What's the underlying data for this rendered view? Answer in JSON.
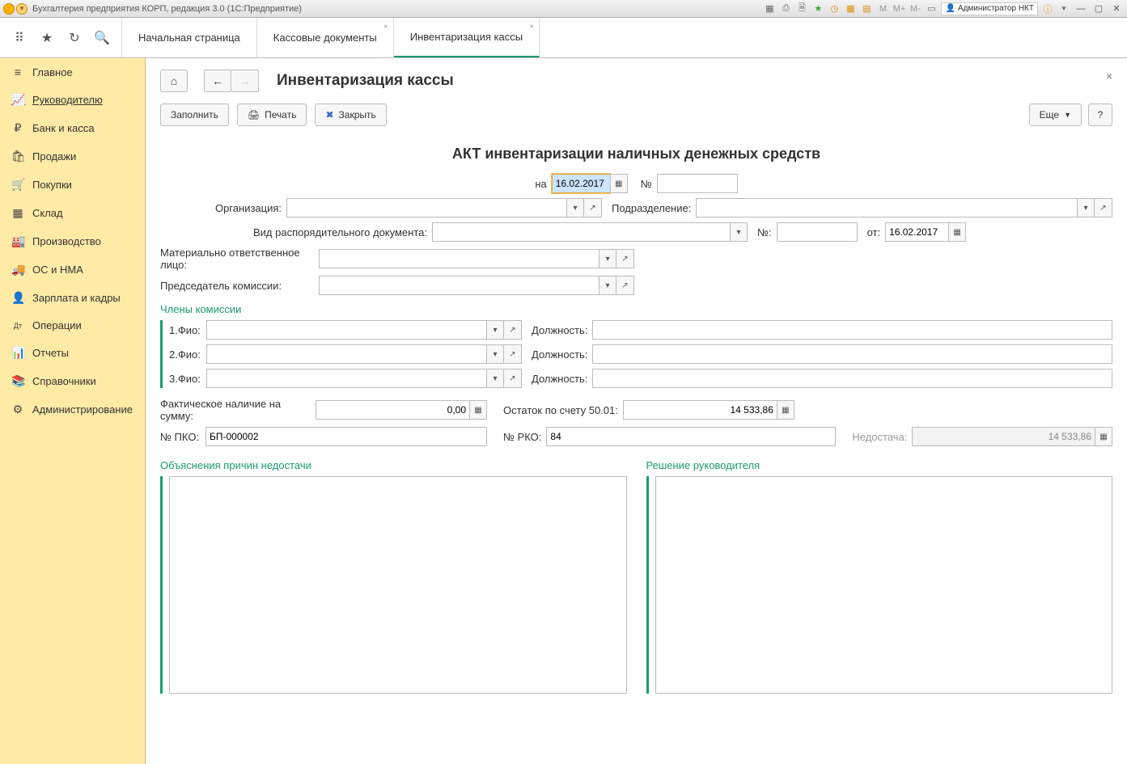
{
  "titlebar": {
    "app_title": "Бухгалтерия предприятия КОРП, редакция 3.0  (1С:Предприятие)",
    "user": "Администратор НКТ",
    "tool_labels": [
      "M",
      "M+",
      "M-"
    ]
  },
  "topbar": {
    "tabs": [
      {
        "label": "Начальная страница",
        "closable": false
      },
      {
        "label": "Кассовые документы",
        "closable": true
      },
      {
        "label": "Инвентаризация кассы",
        "closable": true,
        "active": true
      }
    ]
  },
  "sidebar": {
    "items": [
      {
        "icon": "≡",
        "label": "Главное"
      },
      {
        "icon": "📈",
        "label": "Руководителю",
        "active": true
      },
      {
        "icon": "₽",
        "label": "Банк и касса"
      },
      {
        "icon": "🛍",
        "label": "Продажи"
      },
      {
        "icon": "🛒",
        "label": "Покупки"
      },
      {
        "icon": "▦",
        "label": "Склад"
      },
      {
        "icon": "🏭",
        "label": "Производство"
      },
      {
        "icon": "🚚",
        "label": "ОС и НМА"
      },
      {
        "icon": "👤",
        "label": "Зарплата и кадры"
      },
      {
        "icon": "Дт",
        "label": "Операции"
      },
      {
        "icon": "📊",
        "label": "Отчеты"
      },
      {
        "icon": "📚",
        "label": "Справочники"
      },
      {
        "icon": "⚙",
        "label": "Администрирование"
      }
    ]
  },
  "page": {
    "title": "Инвентаризация кассы",
    "toolbar": {
      "fill": "Заполнить",
      "print": "Печать",
      "close": "Закрыть",
      "more": "Еще"
    },
    "form_title": "АКТ инвентаризации наличных денежных средств",
    "labels": {
      "on_date": "на",
      "number": "№",
      "org": "Организация:",
      "dept": "Подразделение:",
      "order_type": "Вид распорядительного документа:",
      "order_num": "№:",
      "from": "от:",
      "resp_person": "Материально ответственное лицо:",
      "chairman": "Председатель комиссии:",
      "members": "Члены комиссии",
      "fio1": "1.Фио:",
      "fio2": "2.Фио:",
      "fio3": "3.Фио:",
      "position": "Должность:",
      "actual_sum": "Фактическое наличие на сумму:",
      "balance": "Остаток по счету 50.01:",
      "pko": "№ ПКО:",
      "rko": "№ РКО:",
      "shortage": "Недостача:",
      "explanation": "Объяснения причин недостачи",
      "decision": "Решение руководителя"
    },
    "values": {
      "date": "16.02.2017",
      "number": "",
      "org": "",
      "dept": "",
      "order_type": "",
      "order_num": "",
      "order_date": "16.02.2017",
      "resp_person": "",
      "chairman": "",
      "fio1": "",
      "pos1": "",
      "fio2": "",
      "pos2": "",
      "fio3": "",
      "pos3": "",
      "actual_sum": "0,00",
      "balance": "14 533,86",
      "pko": "БП-000002",
      "rko": "84",
      "shortage": "14 533,86",
      "explanation": "",
      "decision": ""
    }
  }
}
